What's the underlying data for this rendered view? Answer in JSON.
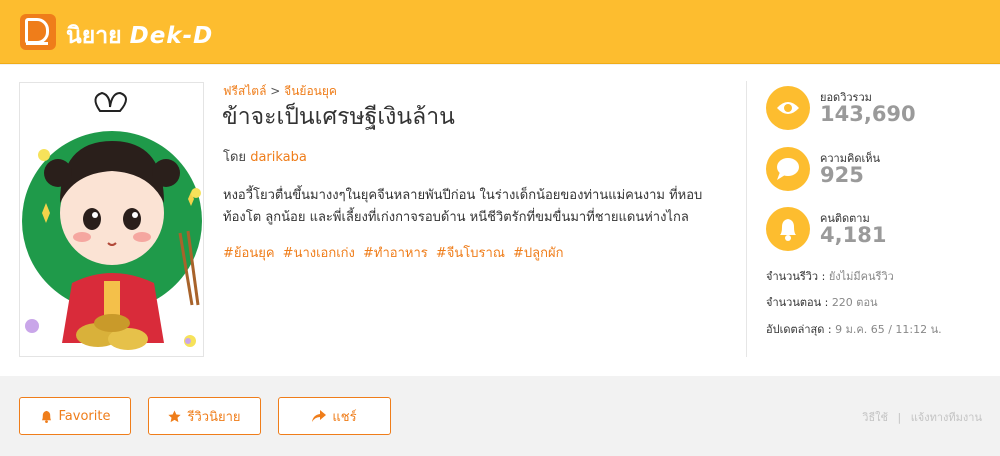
{
  "header": {
    "logo_prefix": "นิยาย",
    "logo_brand": "Dek-D"
  },
  "breadcrumb": {
    "category": "ฟรีสไตล์",
    "separator": ">",
    "subcategory": "จีนย้อนยุค"
  },
  "novel": {
    "title": "ข้าจะเป็นเศรษฐีเงินล้าน",
    "by_label": "โดย",
    "author": "darikaba",
    "synopsis_line1": "หงอวี้โยวตื่นขึ้นมางงๆในยุคจีนหลายพันปีก่อน ในร่างเด็กน้อยของท่านแม่คนงาม ที่หอบ",
    "synopsis_line2": "ท้องโต ลูกน้อย และพี่เลี้ยงที่เก่งกาจรอบด้าน หนีชีวิตรักที่ขมขื่นมาที่ชายแดนห่างไกล",
    "tags": [
      "#ย้อนยุค",
      "#นางเอกเก่ง",
      "#ทำอาหาร",
      "#จีนโบราณ",
      "#ปลูกผัก"
    ]
  },
  "stats": {
    "views_label": "ยอดวิวรวม",
    "views_value": "143,690",
    "comments_label": "ความคิดเห็น",
    "comments_value": "925",
    "followers_label": "คนติดตาม",
    "followers_value": "4,181"
  },
  "meta": {
    "reviews_label": "จำนวนรีวิว :",
    "reviews_value": "ยังไม่มีคนรีวิว",
    "episodes_label": "จำนวนตอน :",
    "episodes_value": "220 ตอน",
    "updated_label": "อัปเดตล่าสุด :",
    "updated_value": "9 ม.ค. 65 / 11:12 น."
  },
  "actions": {
    "favorite": "Favorite",
    "review": "รีวิวนิยาย",
    "share": "แชร์"
  },
  "footer": {
    "how_to": "วิธีใช้",
    "separator": "|",
    "report": "แจ้งทางทีมงาน"
  },
  "colors": {
    "brand_yellow": "#fdbd2f",
    "accent_orange": "#ef7d1a"
  }
}
